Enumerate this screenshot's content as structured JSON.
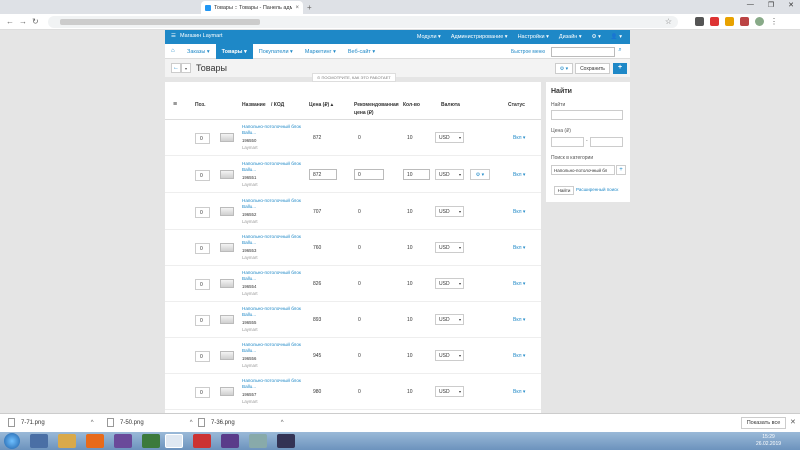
{
  "browser": {
    "tab_title": "Товары :: Товары - Панель адм...",
    "tab_close": "×",
    "new_tab": "+",
    "controls": [
      "—",
      "❐",
      "✕"
    ]
  },
  "admin": {
    "shop_name": "Магазин Laymart",
    "top_menu": [
      "Модули ▾",
      "Администрирование ▾",
      "Настройки ▾",
      "Дизайн ▾",
      "⚙ ▾",
      "👤 ▾"
    ],
    "nav": [
      "Заказы ▾",
      "Товары ▾",
      "Покупатели ▾",
      "Маркетинг ▾",
      "Веб-сайт ▾"
    ],
    "quick_menu_label": "Быстрое меню",
    "page_title": "Товары",
    "how_it_works": "⊙ ПОСМОТРИТЕ, КАК ЭТО РАБОТАЕТ",
    "save_label": "Сохранить",
    "plus_label": "+",
    "gear_label": "⚙ ▾"
  },
  "table": {
    "headers": {
      "pos": "Поз.",
      "name": "Название",
      "code": "/  КОД",
      "price": "Цена (₽) ▴",
      "rec": "Рекомендованная цена (₽)",
      "qty": "Кол-во",
      "currency": "Валюта",
      "status": "Статус"
    },
    "rows": [
      {
        "pos": "0",
        "name": "Напольно-потолочный блок Ballu...",
        "code": "196550",
        "brand": "Laymart",
        "price": "872",
        "rec": "0",
        "qty": "10",
        "currency": "USD",
        "status": "Вкл ▾"
      },
      {
        "pos": "0",
        "name": "Напольно-потолочный блок Ballu...",
        "code": "196551",
        "brand": "Laymart",
        "price": "872",
        "rec": "0",
        "qty": "10",
        "currency": "USD",
        "status": "Вкл ▾"
      },
      {
        "pos": "0",
        "name": "Напольно-потолочный блок Ballu...",
        "code": "196552",
        "brand": "Laymart",
        "price": "707",
        "rec": "0",
        "qty": "10",
        "currency": "USD",
        "status": "Вкл ▾"
      },
      {
        "pos": "0",
        "name": "Напольно-потолочный блок Ballu...",
        "code": "196553",
        "brand": "Laymart",
        "price": "760",
        "rec": "0",
        "qty": "10",
        "currency": "USD",
        "status": "Вкл ▾"
      },
      {
        "pos": "0",
        "name": "Напольно-потолочный блок Ballu...",
        "code": "196554",
        "brand": "Laymart",
        "price": "826",
        "rec": "0",
        "qty": "10",
        "currency": "USD",
        "status": "Вкл ▾"
      },
      {
        "pos": "0",
        "name": "Напольно-потолочный блок Ballu...",
        "code": "196555",
        "brand": "Laymart",
        "price": "893",
        "rec": "0",
        "qty": "10",
        "currency": "USD",
        "status": "Вкл ▾"
      },
      {
        "pos": "0",
        "name": "Напольно-потолочный блок Ballu...",
        "code": "196556",
        "brand": "Laymart",
        "price": "945",
        "rec": "0",
        "qty": "10",
        "currency": "USD",
        "status": "Вкл ▾"
      },
      {
        "pos": "0",
        "name": "Напольно-потолочный блок Ballu...",
        "code": "196557",
        "brand": "Laymart",
        "price": "980",
        "rec": "0",
        "qty": "10",
        "currency": "USD",
        "status": "Вкл ▾"
      }
    ]
  },
  "filter": {
    "title": "Найти",
    "find_label": "Найти",
    "price_label": "Цена (₽)",
    "category_label": "Поиск в категории",
    "category_value": "Напольно-потолочный бл",
    "find_button": "Найти",
    "advanced": "Расширенный поиск"
  },
  "downloads": {
    "items": [
      "7-71.png",
      "7-50.png",
      "7-36.png"
    ],
    "show_all": "Показать все"
  },
  "taskbar": {
    "time": "15:29",
    "date": "26.02.2019"
  }
}
